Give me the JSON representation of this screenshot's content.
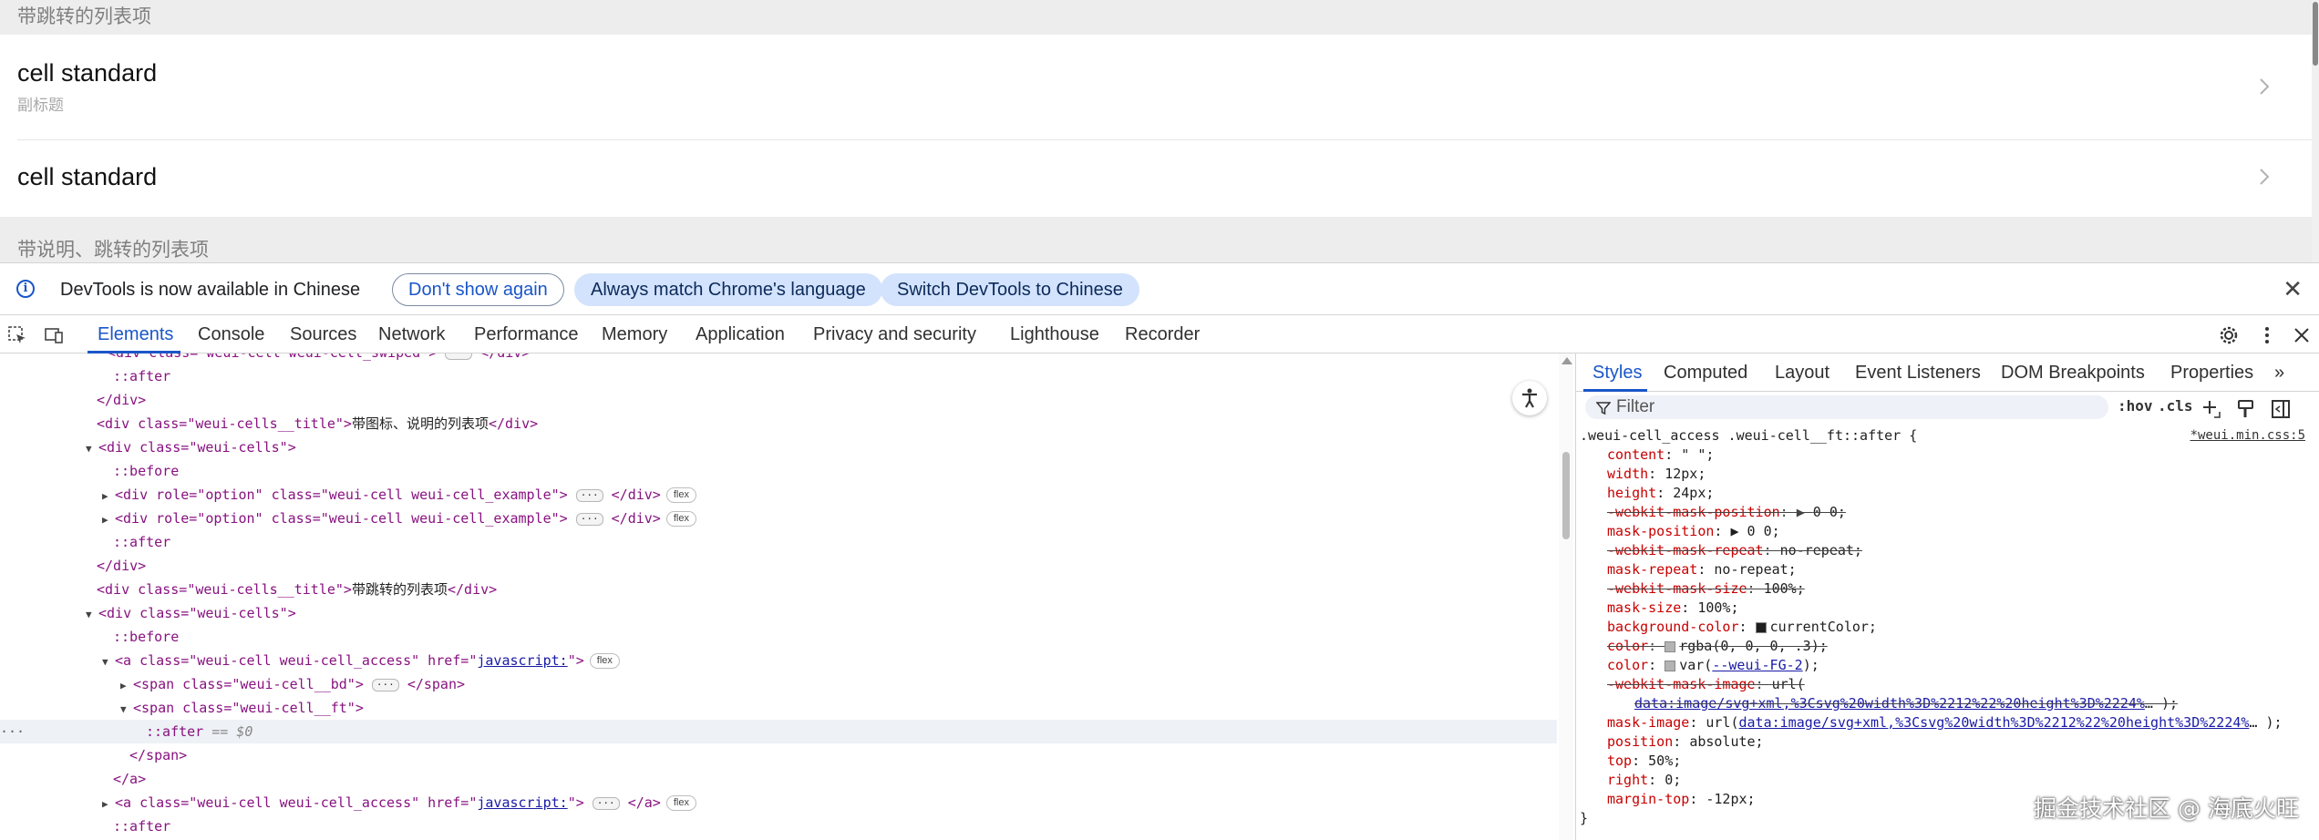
{
  "preview": {
    "section1_title": "带跳转的列表项",
    "cell1_title": "cell standard",
    "cell1_subtitle": "副标题",
    "cell2_title": "cell standard",
    "section2_title": "带说明、跳转的列表项"
  },
  "infobar": {
    "message": "DevTools is now available in Chinese",
    "btn_dont_show": "Don't show again",
    "btn_match": "Always match Chrome's language",
    "btn_switch": "Switch DevTools to Chinese",
    "close": "✕"
  },
  "tabs": [
    "Elements",
    "Console",
    "Sources",
    "Network",
    "Performance",
    "Memory",
    "Application",
    "Privacy and security",
    "Lighthouse",
    "Recorder"
  ],
  "styles_tabs": [
    "Styles",
    "Computed",
    "Layout",
    "Event Listeners",
    "DOM Breakpoints",
    "Properties",
    "»"
  ],
  "filter": {
    "placeholder": "Filter",
    "hov": ":hov",
    "cls": ".cls"
  },
  "dom": {
    "l0_tag": "<div class=\"weui-cell  weui-cell_swiped\">",
    "after": "::after",
    "before": "::before",
    "close_div": "</div>",
    "title1_open": "<div class=\"weui-cells__title\">",
    "title1_text": "带图标、说明的列表项",
    "cells_open": "<div class=\"weui-cells\">",
    "option_open": "<div role=\"option\" class=\"weui-cell  weui-cell_example\">",
    "ellipsis": "···",
    "flex": "flex",
    "title2_text": "带跳转的列表项",
    "a_open": "<a class=\"weui-cell  weui-cell_access\" href=\"",
    "a_href": "javascript:",
    "a_close_open": "\">",
    "span_bd": "<span class=\"weui-cell__bd\">",
    "close_span": "</span>",
    "span_ft": "<span class=\"weui-cell__ft\">",
    "after_sel": "::after",
    "eq_dollar": " == $0",
    "close_a": "</a>"
  },
  "css": {
    "selector": ".weui-cell_access .weui-cell__ft::after {",
    "source": "*weui.min.css:5",
    "content_name": "content",
    "content_val": "\" \";",
    "width_name": "width",
    "width_val": "12px;",
    "height_name": "height",
    "height_val": "24px;",
    "wmp_name": "-webkit-mask-position",
    "wmp_val": "0 0;",
    "mp_name": "mask-position",
    "mp_val": "0 0;",
    "wmr_name": "-webkit-mask-repeat",
    "wmr_val": "no-repeat;",
    "mr_name": "mask-repeat",
    "mr_val": "no-repeat;",
    "wms_name": "-webkit-mask-size",
    "wms_val": "100%;",
    "ms_name": "mask-size",
    "ms_val": "100%;",
    "bg_name": "background-color",
    "bg_val": "currentColor;",
    "color1_name": "color",
    "color1_val": "rgba(0, 0, 0, .3);",
    "color2_name": "color",
    "color2_val_a": "var(",
    "color2_var": "--weui-FG-2",
    "color2_val_b": ");",
    "wmi_name": "-webkit-mask-image",
    "wmi_val": "url(",
    "wmi_url": "data:image/svg+xml,%3Csvg%20width%3D%2212%22%20height%3D%2224%",
    "wmi_end": "… );",
    "mi_name": "mask-image",
    "mi_val": "url(",
    "mi_url": "data:image/svg+xml,%3Csvg%20width%3D%2212%22%20height%3D%2224%",
    "mi_end": "… );",
    "pos_name": "position",
    "pos_val": "absolute;",
    "top_name": "top",
    "top_val": "50%;",
    "right_name": "right",
    "right_val": "0;",
    "mt_name": "margin-top",
    "mt_val": "-12px;",
    "close": "}"
  },
  "watermark": "掘金技术社区 @ 海底火旺",
  "colors": {
    "accent": "#1a56c8",
    "tag": "#881280",
    "attr": "#994500",
    "value": "#1a1aa6",
    "prop": "#c80000"
  }
}
